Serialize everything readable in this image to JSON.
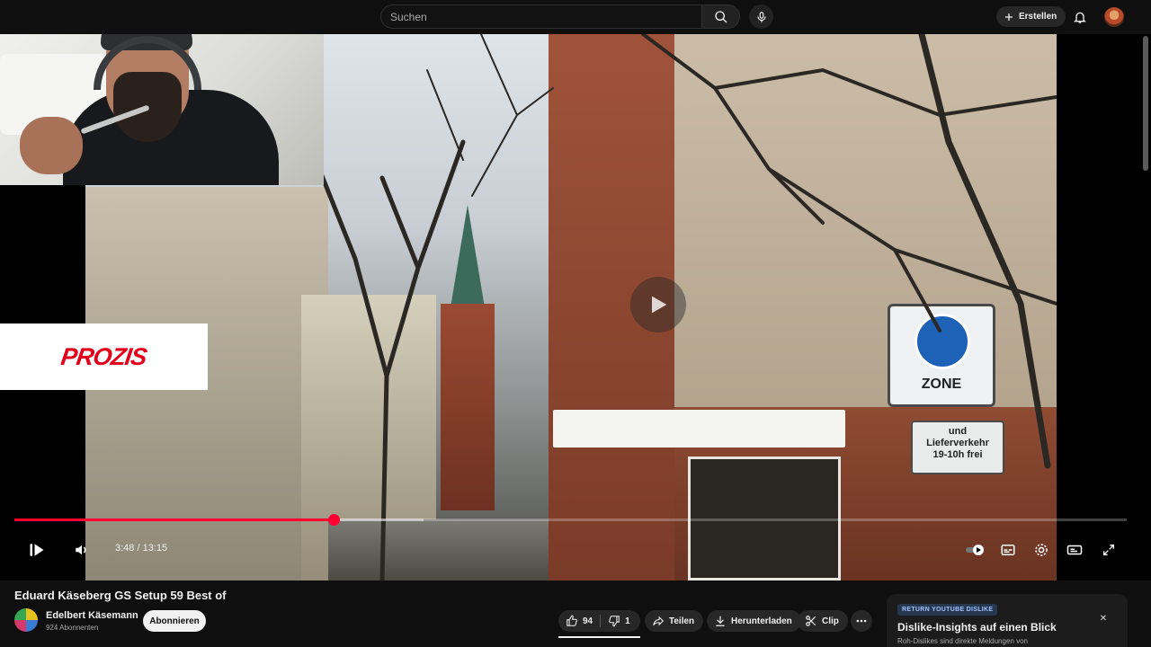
{
  "header": {
    "search_placeholder": "Suchen",
    "create_label": "Erstellen"
  },
  "player": {
    "ad_brand": "PROZIS",
    "time": "3:48 / 13:15",
    "current_time": "3:48",
    "duration": "13:15",
    "progress": 0.287,
    "buffered": 0.368,
    "sign_zone": "ZONE",
    "sign_delivery_1": "und",
    "sign_delivery_2": "Lieferverkehr",
    "sign_delivery_3": "19-10h frei"
  },
  "video": {
    "title": "Eduard Käseberg GS Setup 59 Best of",
    "channel_name": "Edelbert Käsemann",
    "subscribers": "924 Abonnenten",
    "subscribe_label": "Abonnieren",
    "likes": "94",
    "dislikes": "1",
    "share_label": "Teilen",
    "download_label": "Herunterladen",
    "clip_label": "Clip"
  },
  "ryd": {
    "badge": "RETURN YOUTUBE DISLIKE",
    "title": "Dislike-Insights auf einen Blick",
    "subtitle": "Roh-Dislikes sind direkte Meldungen von"
  },
  "colors": {
    "accent_red": "#ff0033",
    "background": "#0f0f0f",
    "ad_red": "#e3001b"
  }
}
